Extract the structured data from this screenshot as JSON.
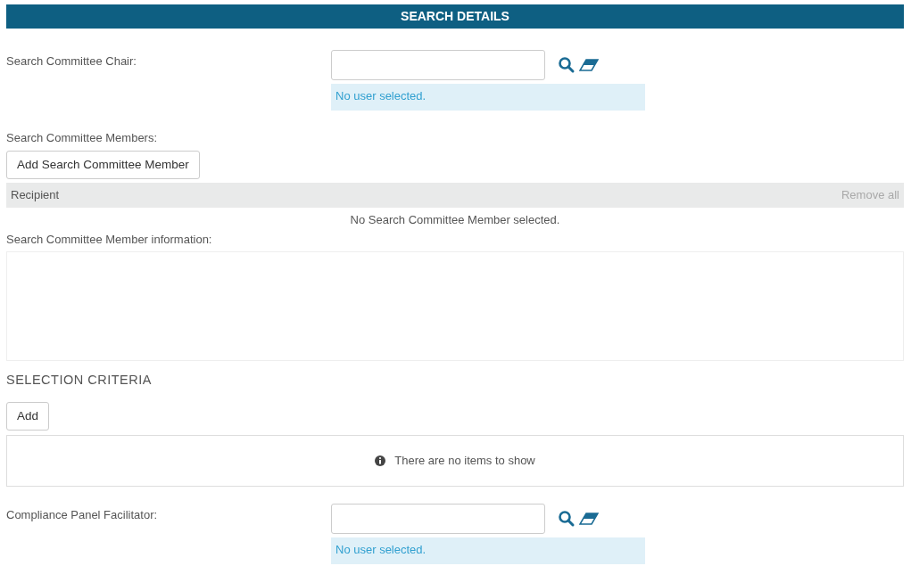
{
  "header": {
    "title": "SEARCH DETAILS"
  },
  "chair": {
    "label": "Search Committee Chair:",
    "status": "No user selected."
  },
  "members": {
    "label": "Search Committee Members:",
    "add_button": "Add Search Committee Member",
    "column": "Recipient",
    "remove_all": {
      "label": "Remove all",
      "disabled": true
    },
    "empty": "No Search Committee Member selected."
  },
  "member_info": {
    "label": "Search Committee Member information:"
  },
  "criteria": {
    "title": "SELECTION CRITERIA",
    "add_button": "Add",
    "empty": "There are no items to show"
  },
  "facilitator": {
    "label": "Compliance Panel Facilitator:",
    "status": "No user selected."
  }
}
